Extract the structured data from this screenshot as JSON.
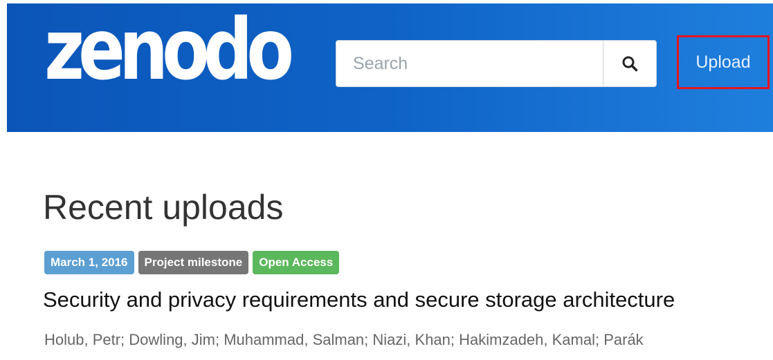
{
  "brand": {
    "logo_text": "zenodo",
    "navbar_color": "#0f63c7"
  },
  "search": {
    "placeholder": "Search",
    "icon": "search-icon"
  },
  "nav": {
    "upload_label": "Upload",
    "highlight_color": "#e8141c"
  },
  "main": {
    "section_title": "Recent uploads",
    "records": [
      {
        "badges": {
          "date": "March 1, 2016",
          "type": "Project milestone",
          "access": "Open Access"
        },
        "title": "Security and privacy requirements and secure storage architecture",
        "authors": "Holub, Petr; Dowling, Jim; Muhammad, Salman; Niazi, Khan; Hakimzadeh, Kamal; Parák"
      }
    ]
  },
  "colors": {
    "badge_date": "#5b9fd3",
    "badge_type": "#767676",
    "badge_access": "#5cb85c"
  }
}
